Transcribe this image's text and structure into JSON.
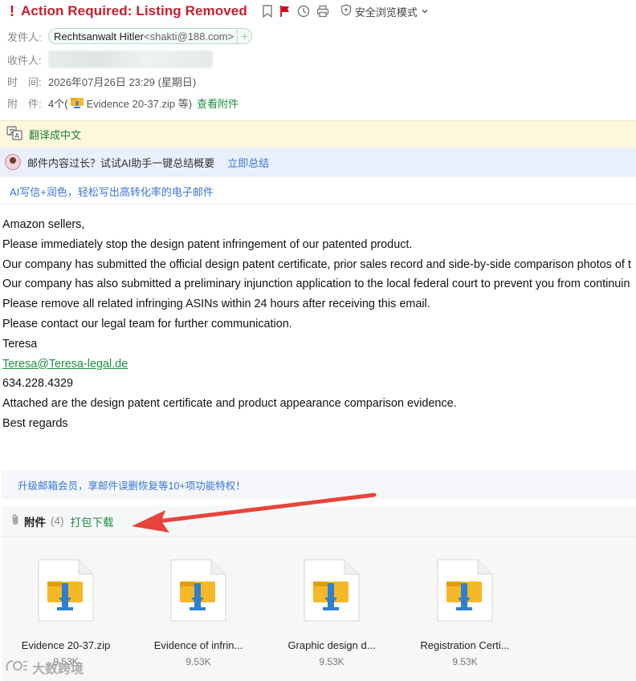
{
  "subject": {
    "marker": "!",
    "title": "Action Required: Listing Removed"
  },
  "toolbar": {
    "safe_mode_label": "安全浏览模式"
  },
  "meta": {
    "from_label": "发件人:",
    "sender_name": "Rechtsanwalt Hitler",
    "sender_email": "<shakti@188.com>",
    "add_label": "+",
    "to_label": "收件人:",
    "time_label": "时　间:",
    "time_value": "2026年07月26日 23:29 (星期日)",
    "attach_label": "附　件:",
    "attach_count": "4个(",
    "attach_first": "Evidence 20-37.zip 等)",
    "view_attachments": "查看附件"
  },
  "translate_bar": {
    "label": "翻译成中文"
  },
  "ai_bar": {
    "text": "邮件内容过长？试试AI助手一键总结概要",
    "link": "立即总结"
  },
  "ai_write": "AI写信+润色，轻松写出高转化率的电子邮件",
  "body": {
    "lines": [
      "Amazon sellers,",
      "Please immediately stop the design patent infringement of our patented product.",
      "Our company has submitted the official design patent certificate, prior sales record and side-by-side comparison photos of t",
      "Our company has also submitted a preliminary injunction application to the local federal court to prevent you from continuin",
      "Please remove all related infringing ASINs within 24 hours after receiving this email.",
      "Please contact our legal team for further communication.",
      "Teresa"
    ],
    "email_link": "Teresa@Teresa-legal.de",
    "phone": "634.228.4329",
    "lines_after": [
      "Attached are the design patent certificate and product appearance comparison evidence.",
      "Best regards"
    ]
  },
  "upgrade_bar": "升级邮箱会员，享邮件误删恢复等10+项功能特权！",
  "attachments": {
    "title": "附件",
    "count": "(4)",
    "download_all": "打包下载",
    "items": [
      {
        "name": "Evidence 20-37.zip",
        "size": "9.53K"
      },
      {
        "name": "Evidence of infrin...",
        "size": "9.53K"
      },
      {
        "name": "Graphic design d...",
        "size": "9.53K"
      },
      {
        "name": "Registration Certi...",
        "size": "9.53K"
      }
    ]
  },
  "watermark": "大数跨境",
  "colors": {
    "subject_red": "#c81e2a",
    "link_green": "#1e8e3e",
    "link_blue": "#3a76d6",
    "translate_bg": "#fdf8dc",
    "ai_bg": "#e9f0fb",
    "arrow_red": "#e8443a"
  }
}
